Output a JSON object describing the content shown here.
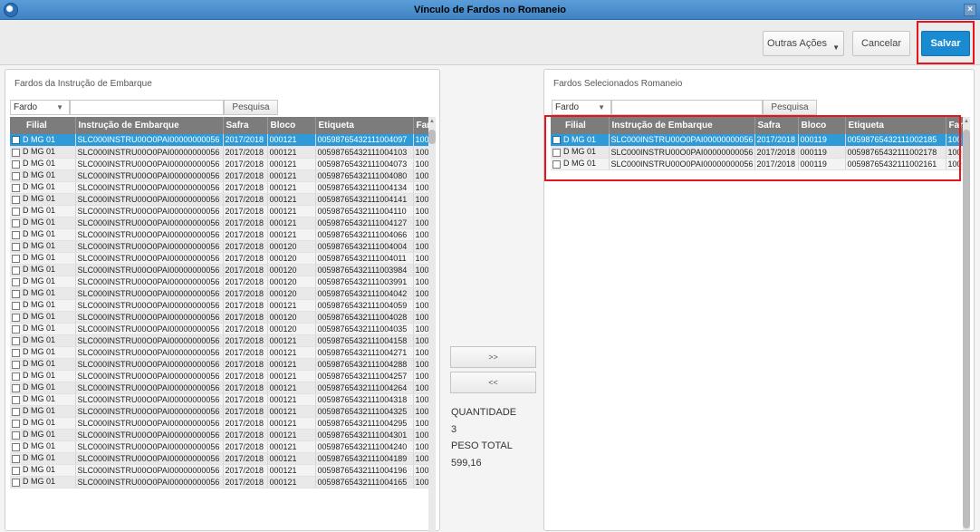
{
  "window": {
    "title": "Vínculo de Fardos no Romaneio",
    "close": "×"
  },
  "toolbar": {
    "outras": "Outras Ações",
    "cancelar": "Cancelar",
    "salvar": "Salvar"
  },
  "left": {
    "title": "Fardos da Instrução de Embarque",
    "filter": {
      "field": "Fardo",
      "search": "Pesquisa"
    },
    "columns": [
      "Filial",
      "Instrução de Embarque",
      "Safra",
      "Bloco",
      "Etiqueta",
      "Far"
    ],
    "rows": [
      [
        "D MG 01",
        "SLC000INSTRU00O0PAI00000000056",
        "2017/2018",
        "000121",
        "00598765432111004097",
        "100"
      ],
      [
        "D MG 01",
        "SLC000INSTRU00O0PAI00000000056",
        "2017/2018",
        "000121",
        "00598765432111004103",
        "100"
      ],
      [
        "D MG 01",
        "SLC000INSTRU00O0PAI00000000056",
        "2017/2018",
        "000121",
        "00598765432111004073",
        "100"
      ],
      [
        "D MG 01",
        "SLC000INSTRU00O0PAI00000000056",
        "2017/2018",
        "000121",
        "00598765432111004080",
        "100"
      ],
      [
        "D MG 01",
        "SLC000INSTRU00O0PAI00000000056",
        "2017/2018",
        "000121",
        "00598765432111004134",
        "100"
      ],
      [
        "D MG 01",
        "SLC000INSTRU00O0PAI00000000056",
        "2017/2018",
        "000121",
        "00598765432111004141",
        "100"
      ],
      [
        "D MG 01",
        "SLC000INSTRU00O0PAI00000000056",
        "2017/2018",
        "000121",
        "00598765432111004110",
        "100"
      ],
      [
        "D MG 01",
        "SLC000INSTRU00O0PAI00000000056",
        "2017/2018",
        "000121",
        "00598765432111004127",
        "100"
      ],
      [
        "D MG 01",
        "SLC000INSTRU00O0PAI00000000056",
        "2017/2018",
        "000121",
        "00598765432111004066",
        "100"
      ],
      [
        "D MG 01",
        "SLC000INSTRU00O0PAI00000000056",
        "2017/2018",
        "000120",
        "00598765432111004004",
        "100"
      ],
      [
        "D MG 01",
        "SLC000INSTRU00O0PAI00000000056",
        "2017/2018",
        "000120",
        "00598765432111004011",
        "100"
      ],
      [
        "D MG 01",
        "SLC000INSTRU00O0PAI00000000056",
        "2017/2018",
        "000120",
        "00598765432111003984",
        "100"
      ],
      [
        "D MG 01",
        "SLC000INSTRU00O0PAI00000000056",
        "2017/2018",
        "000120",
        "00598765432111003991",
        "100"
      ],
      [
        "D MG 01",
        "SLC000INSTRU00O0PAI00000000056",
        "2017/2018",
        "000120",
        "00598765432111004042",
        "100"
      ],
      [
        "D MG 01",
        "SLC000INSTRU00O0PAI00000000056",
        "2017/2018",
        "000121",
        "00598765432111004059",
        "100"
      ],
      [
        "D MG 01",
        "SLC000INSTRU00O0PAI00000000056",
        "2017/2018",
        "000120",
        "00598765432111004028",
        "100"
      ],
      [
        "D MG 01",
        "SLC000INSTRU00O0PAI00000000056",
        "2017/2018",
        "000120",
        "00598765432111004035",
        "100"
      ],
      [
        "D MG 01",
        "SLC000INSTRU00O0PAI00000000056",
        "2017/2018",
        "000121",
        "00598765432111004158",
        "100"
      ],
      [
        "D MG 01",
        "SLC000INSTRU00O0PAI00000000056",
        "2017/2018",
        "000121",
        "00598765432111004271",
        "100"
      ],
      [
        "D MG 01",
        "SLC000INSTRU00O0PAI00000000056",
        "2017/2018",
        "000121",
        "00598765432111004288",
        "100"
      ],
      [
        "D MG 01",
        "SLC000INSTRU00O0PAI00000000056",
        "2017/2018",
        "000121",
        "00598765432111004257",
        "100"
      ],
      [
        "D MG 01",
        "SLC000INSTRU00O0PAI00000000056",
        "2017/2018",
        "000121",
        "00598765432111004264",
        "100"
      ],
      [
        "D MG 01",
        "SLC000INSTRU00O0PAI00000000056",
        "2017/2018",
        "000121",
        "00598765432111004318",
        "100"
      ],
      [
        "D MG 01",
        "SLC000INSTRU00O0PAI00000000056",
        "2017/2018",
        "000121",
        "00598765432111004325",
        "100"
      ],
      [
        "D MG 01",
        "SLC000INSTRU00O0PAI00000000056",
        "2017/2018",
        "000121",
        "00598765432111004295",
        "100"
      ],
      [
        "D MG 01",
        "SLC000INSTRU00O0PAI00000000056",
        "2017/2018",
        "000121",
        "00598765432111004301",
        "100"
      ],
      [
        "D MG 01",
        "SLC000INSTRU00O0PAI00000000056",
        "2017/2018",
        "000121",
        "00598765432111004240",
        "100"
      ],
      [
        "D MG 01",
        "SLC000INSTRU00O0PAI00000000056",
        "2017/2018",
        "000121",
        "00598765432111004189",
        "100"
      ],
      [
        "D MG 01",
        "SLC000INSTRU00O0PAI00000000056",
        "2017/2018",
        "000121",
        "00598765432111004196",
        "100"
      ],
      [
        "D MG 01",
        "SLC000INSTRU00O0PAI00000000056",
        "2017/2018",
        "000121",
        "00598765432111004165",
        "100"
      ]
    ]
  },
  "right": {
    "title": "Fardos Selecionados Romaneio",
    "filter": {
      "field": "Fardo",
      "search": "Pesquisa"
    },
    "columns": [
      "Filial",
      "Instrução de Embarque",
      "Safra",
      "Bloco",
      "Etiqueta",
      "Far"
    ],
    "rows": [
      [
        "D MG 01",
        "SLC000INSTRU00O0PAI00000000056",
        "2017/2018",
        "000119",
        "00598765432111002185",
        "100"
      ],
      [
        "D MG 01",
        "SLC000INSTRU00O0PAI00000000056",
        "2017/2018",
        "000119",
        "00598765432111002178",
        "100"
      ],
      [
        "D MG 01",
        "SLC000INSTRU00O0PAI00000000056",
        "2017/2018",
        "000119",
        "00598765432111002161",
        "100"
      ]
    ]
  },
  "middle": {
    "add": ">>",
    "remove": "<<",
    "quantidade_label": "QUANTIDADE",
    "quantidade": "3",
    "peso_label": "PESO TOTAL",
    "peso": "599,16"
  },
  "colors": {
    "accent": "#1a8bd1",
    "highlight": "#e8141c",
    "selected_row": "#2f9ad8",
    "header": "#7c7c7c"
  }
}
